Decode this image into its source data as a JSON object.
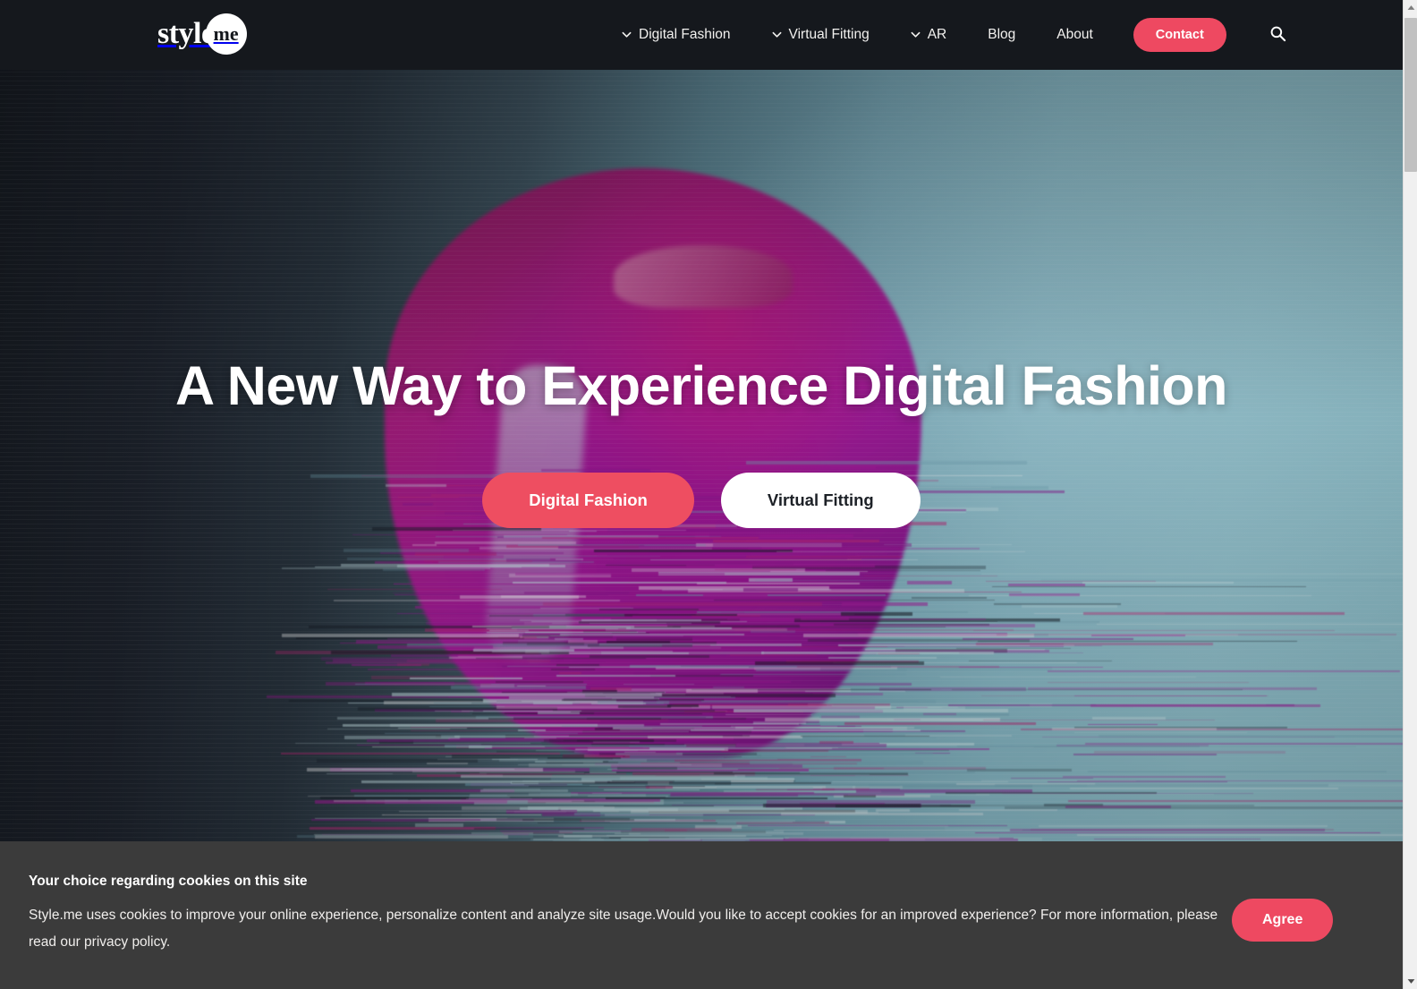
{
  "header": {
    "logo": {
      "word": "style",
      "badge": "me",
      "name": "style-me-logo"
    },
    "nav": [
      {
        "label": "Digital Fashion",
        "has_dropdown": true
      },
      {
        "label": "Virtual Fitting",
        "has_dropdown": true
      },
      {
        "label": "AR",
        "has_dropdown": true
      },
      {
        "label": "Blog",
        "has_dropdown": false
      },
      {
        "label": "About",
        "has_dropdown": false
      }
    ],
    "contact_label": "Contact",
    "search_icon": "search-icon"
  },
  "hero": {
    "title": "A New Way to Experience Digital Fashion",
    "primary_button": "Digital Fashion",
    "secondary_button": "Virtual Fitting"
  },
  "cookie": {
    "title": "Your choice regarding cookies on this site",
    "body": "Style.me uses cookies to improve your online experience, personalize content and analyze site usage.Would you like to accept cookies for an improved experience? For more information, please read our privacy policy.",
    "agree_label": "Agree"
  },
  "colors": {
    "accent": "#ee4961",
    "header_bg": "#15181d",
    "cookie_bg": "#3b3b3b",
    "hero_dark": "#14181e",
    "hero_teal": "#8fc0cb",
    "garment_magenta": "#a81b9d"
  },
  "scrollbar": {
    "up_arrow": "scroll-up-arrow-icon",
    "down_arrow": "scroll-down-arrow-icon",
    "thumb": "scrollbar-thumb"
  }
}
